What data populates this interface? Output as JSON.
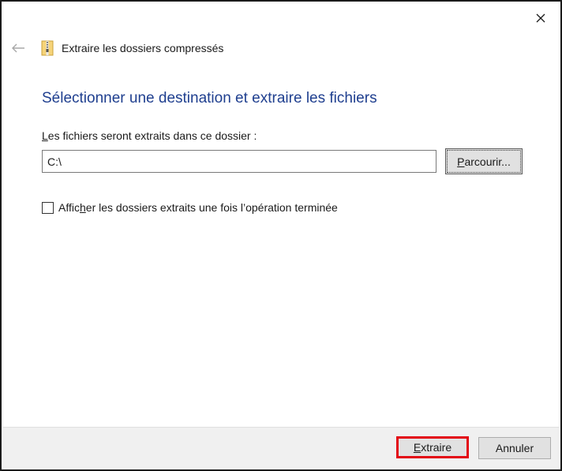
{
  "window": {
    "title": "Extraire les dossiers compressés"
  },
  "main": {
    "heading": "Sélectionner une destination et extraire les fichiers",
    "destination": {
      "label_mnemonic": "L",
      "label_rest": "es fichiers seront extraits dans ce dossier :",
      "value": "C:\\",
      "browse": {
        "mnemonic": "P",
        "rest": "arcourir..."
      }
    },
    "show_when_done": {
      "checked": false,
      "label_before": "Affic",
      "label_mnemonic": "h",
      "label_after": "er les dossiers extraits une fois l’opération terminée"
    }
  },
  "footer": {
    "extract": {
      "mnemonic": "E",
      "rest": "xtraire"
    },
    "cancel_label": "Annuler"
  },
  "colors": {
    "heading": "#1f3f8f",
    "highlight_border": "#e30613"
  },
  "icons": {
    "close": "close-icon",
    "back": "back-arrow-icon",
    "zip": "zip-folder-icon"
  }
}
